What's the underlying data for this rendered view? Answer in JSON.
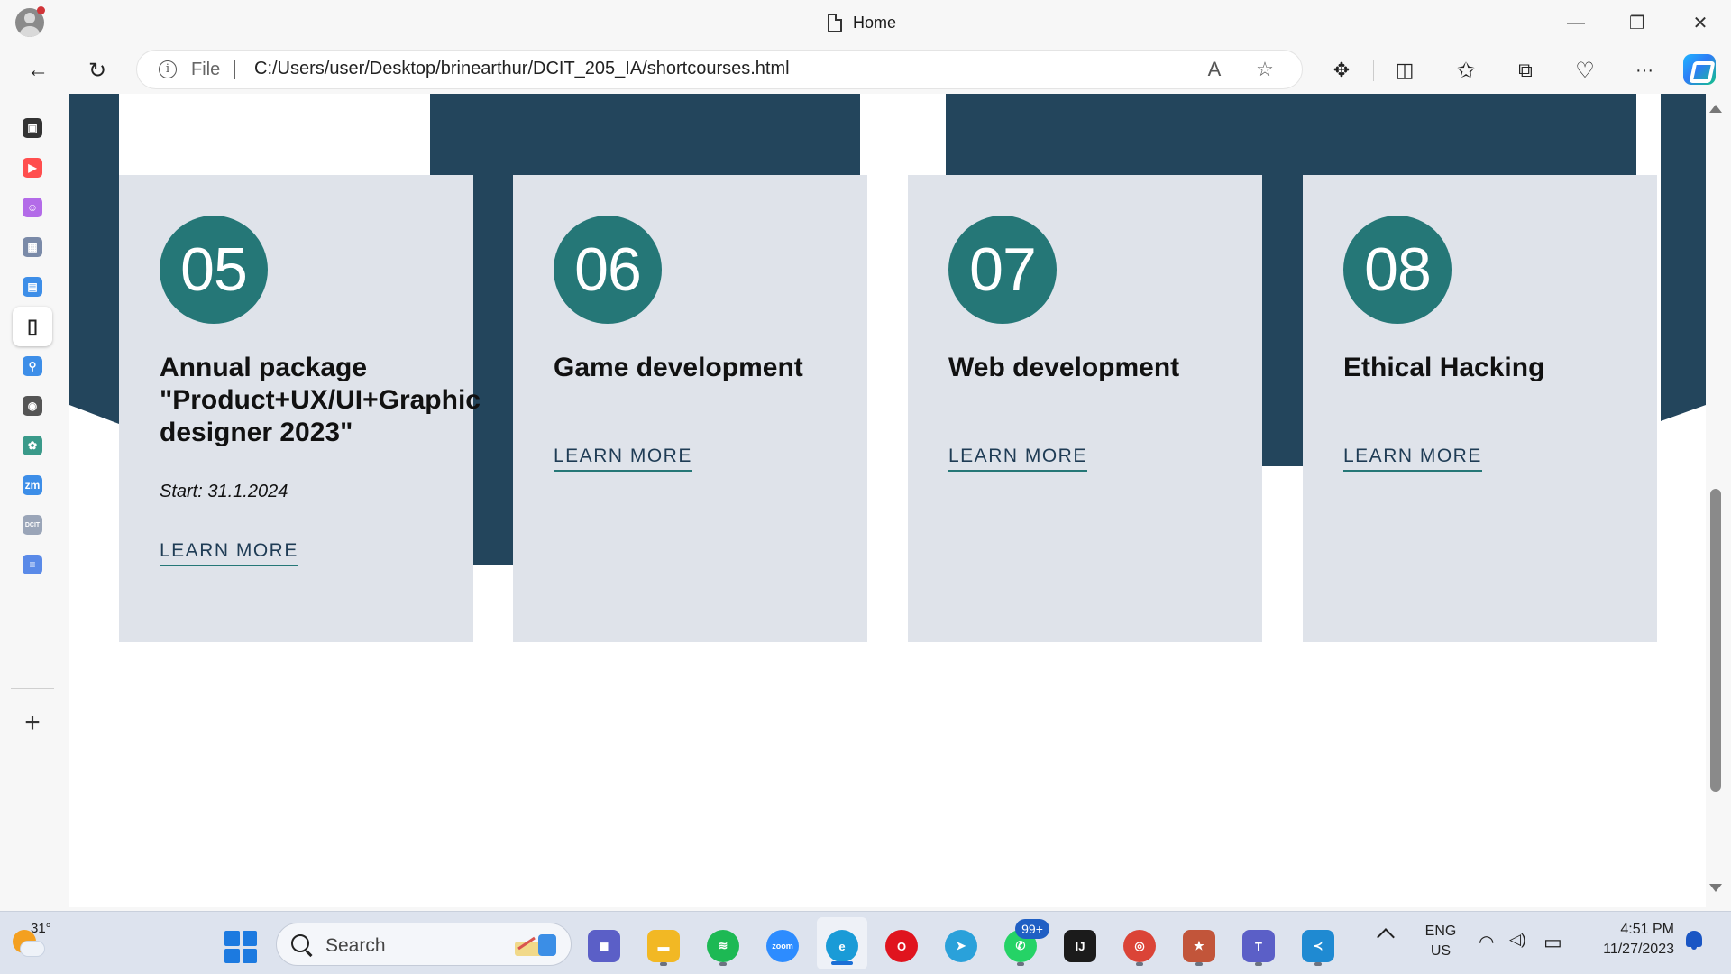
{
  "window": {
    "tab_title": "Home",
    "controls": {
      "minimize": "—",
      "restore": "❐",
      "close": "✕"
    }
  },
  "toolbar": {
    "back_icon": "←",
    "refresh_icon": "↻",
    "address": {
      "info_icon": "i",
      "scheme_label": "File",
      "url": "C:/Users/user/Desktop/brinearthur/DCIT_205_IA/shortcourses.html",
      "read_aloud_icon": "A",
      "favorite_icon": "☆"
    },
    "extensions_icon": "✥",
    "split_icon": "◫",
    "favorites_icon": "✩",
    "collections_icon": "⧉",
    "health_icon": "♡",
    "more_icon": "···"
  },
  "sidebar": {
    "items": [
      {
        "name": "tab-actions-icon",
        "glyph": "▣",
        "color": "#333333"
      },
      {
        "name": "youtube-icon",
        "glyph": "▶",
        "color": "#ff4e4e"
      },
      {
        "name": "chat-bot-icon",
        "glyph": "☺",
        "color": "#b36be8"
      },
      {
        "name": "university-icon",
        "glyph": "▦",
        "color": "#7a8aa8"
      },
      {
        "name": "contacts-icon",
        "glyph": "▤",
        "color": "#3d8ee8"
      },
      {
        "name": "document-icon",
        "glyph": "▯",
        "color": "#222222",
        "active": true
      },
      {
        "name": "search-sidebar-icon",
        "glyph": "⚲",
        "color": "#3d8ee8"
      },
      {
        "name": "github-icon",
        "glyph": "◉",
        "color": "#555555"
      },
      {
        "name": "chatgpt-icon",
        "glyph": "✿",
        "color": "#3a9a8a"
      },
      {
        "name": "zoom-sidebar-icon",
        "glyph": "zm",
        "color": "#3d8ee8"
      },
      {
        "name": "dcit-icon",
        "glyph": "DCIT",
        "color": "#9aa5b8"
      },
      {
        "name": "notes-icon",
        "glyph": "≡",
        "color": "#5a8ae8"
      }
    ],
    "add_icon": "+"
  },
  "courses": [
    {
      "number": "05",
      "title": "Annual package \"Product+UX/UI+Graphic designer 2023\"",
      "start": "Start: 31.1.2024",
      "link": "LEARN MORE"
    },
    {
      "number": "06",
      "title": "Game development",
      "start": "",
      "link": "LEARN MORE"
    },
    {
      "number": "07",
      "title": "Web development",
      "start": "",
      "link": "LEARN MORE"
    },
    {
      "number": "08",
      "title": "Ethical Hacking",
      "start": "",
      "link": "LEARN MORE"
    }
  ],
  "colors": {
    "section_bg": "#23455c",
    "card_bg": "#dfe3ea",
    "accent": "#257777",
    "link_text": "#1f3c55"
  },
  "taskbar": {
    "weather_temp": "31°",
    "search_placeholder": "Search",
    "apps": [
      {
        "name": "teams-chat-icon",
        "glyph": "◼",
        "color": "#5b5fc7"
      },
      {
        "name": "file-explorer-icon",
        "glyph": "▬",
        "color": "#f2b824"
      },
      {
        "name": "spotify-icon",
        "glyph": "≋",
        "color": "#1db954"
      },
      {
        "name": "zoom-icon",
        "glyph": "zoom",
        "color": "#2d8cff"
      },
      {
        "name": "edge-icon",
        "glyph": "e",
        "color": "#1a9bd7"
      },
      {
        "name": "opera-icon",
        "glyph": "O",
        "color": "#e0141e"
      },
      {
        "name": "telegram-icon",
        "glyph": "➤",
        "color": "#2aa1da"
      },
      {
        "name": "whatsapp-icon",
        "glyph": "✆",
        "color": "#25d366"
      },
      {
        "name": "intellij-icon",
        "glyph": "IJ",
        "color": "#1b1b1b"
      },
      {
        "name": "chrome-icon",
        "glyph": "◎",
        "color": "#db4437"
      },
      {
        "name": "game-icon",
        "glyph": "★",
        "color": "#c2553a"
      },
      {
        "name": "teams-icon",
        "glyph": "T",
        "color": "#5b5fc7"
      },
      {
        "name": "vscode-icon",
        "glyph": "≺",
        "color": "#1f8ad2"
      }
    ],
    "whatsapp_badge": "99+",
    "lang_line1": "ENG",
    "lang_line2": "US",
    "wifi_icon": "◠",
    "volume_icon": "◁)",
    "battery_icon": "▭",
    "time": "4:51 PM",
    "date": "11/27/2023"
  }
}
